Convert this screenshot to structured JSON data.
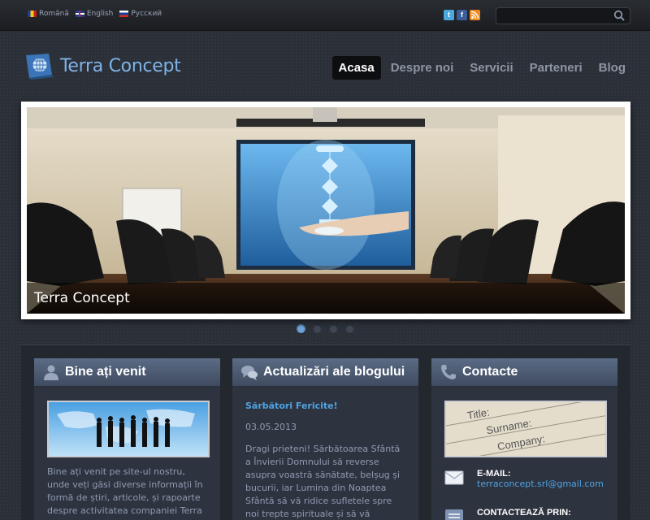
{
  "languages": [
    {
      "label": "Română",
      "flag": "flag-ro"
    },
    {
      "label": "English",
      "flag": "flag-en"
    },
    {
      "label": "Русский",
      "flag": "flag-ru"
    }
  ],
  "social": {
    "twitter": "t",
    "facebook": "f",
    "rss": ""
  },
  "search": {
    "placeholder": ""
  },
  "brand": {
    "name": "Terra Concept"
  },
  "nav": [
    {
      "label": "Acasa",
      "active": true
    },
    {
      "label": "Despre noi",
      "active": false
    },
    {
      "label": "Servicii",
      "active": false
    },
    {
      "label": "Parteneri",
      "active": false
    },
    {
      "label": "Blog",
      "active": false
    }
  ],
  "slider": {
    "caption": "Terra Concept",
    "slide_count": 4,
    "active_index": 0
  },
  "welcome": {
    "title": "Bine ați venit",
    "text": "Bine ați venit pe site-ul nostru, unde veți găsi diverse informații în formă de știri, articole, și rapoarte despre activitatea companiei Terra Concept."
  },
  "blog": {
    "title": "Actualizări ale blogului",
    "post_title": "Sărbători Fericite!",
    "post_date": "03.05.2013",
    "post_body": "Dragi prieteni! Sărbătoarea Sfântă a Învierii Domnului să reverse asupra voastră sănătate, belșug și bucurii, iar Lumina din Noaptea Sfântă să vă ridice sufletele spre noi trepte spirituale și să vă călăuzească pașii pe drumul vieții"
  },
  "contacts": {
    "title": "Contacte",
    "email_label": "E-MAIL:",
    "email": "terraconcept.srl@gmail.com",
    "contact_via_label": "CONTACTEAZĂ PRIN:"
  },
  "colors": {
    "accent": "#4fa3e0",
    "nav_active_bg": "#0d0e10",
    "panel_header": "#4f5d76"
  }
}
